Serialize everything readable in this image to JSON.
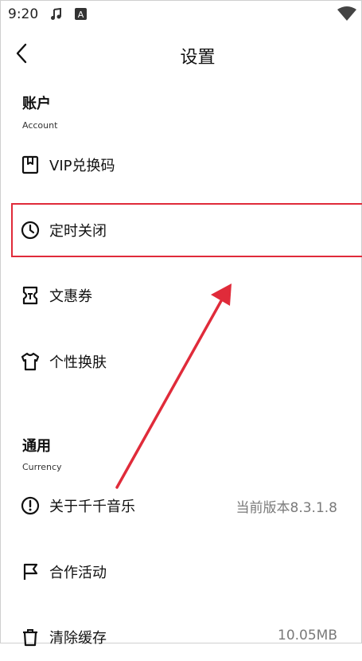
{
  "status_bar": {
    "time": "9:20",
    "icons": [
      "music-note-icon",
      "keyboard-a-icon",
      "wifi-icon"
    ]
  },
  "header": {
    "back_icon": "chevron-left-icon",
    "title": "设置"
  },
  "sections": {
    "account": {
      "title": "账户",
      "subtitle": "Account",
      "items": {
        "vip": {
          "label": "VIP兑换码",
          "icon": "bookmark-icon"
        },
        "timer": {
          "label": "定时关闭",
          "icon": "clock-icon"
        },
        "coupon": {
          "label": "文惠券",
          "icon": "coupon-icon"
        },
        "skin": {
          "label": "个性换肤",
          "icon": "shirt-icon"
        }
      }
    },
    "general": {
      "title": "通用",
      "subtitle": "Currency",
      "items": {
        "about": {
          "label": "关于千千音乐",
          "value": "当前版本8.3.1.8",
          "icon": "info-circle-icon"
        },
        "activity": {
          "label": "合作活动",
          "icon": "flag-icon"
        },
        "cache": {
          "label": "清除缓存",
          "value": "10.05MB",
          "icon": "trash-icon"
        }
      }
    }
  },
  "annotation": {
    "highlight_color": "#e02b3a",
    "arrow_color": "#e02b3a"
  }
}
